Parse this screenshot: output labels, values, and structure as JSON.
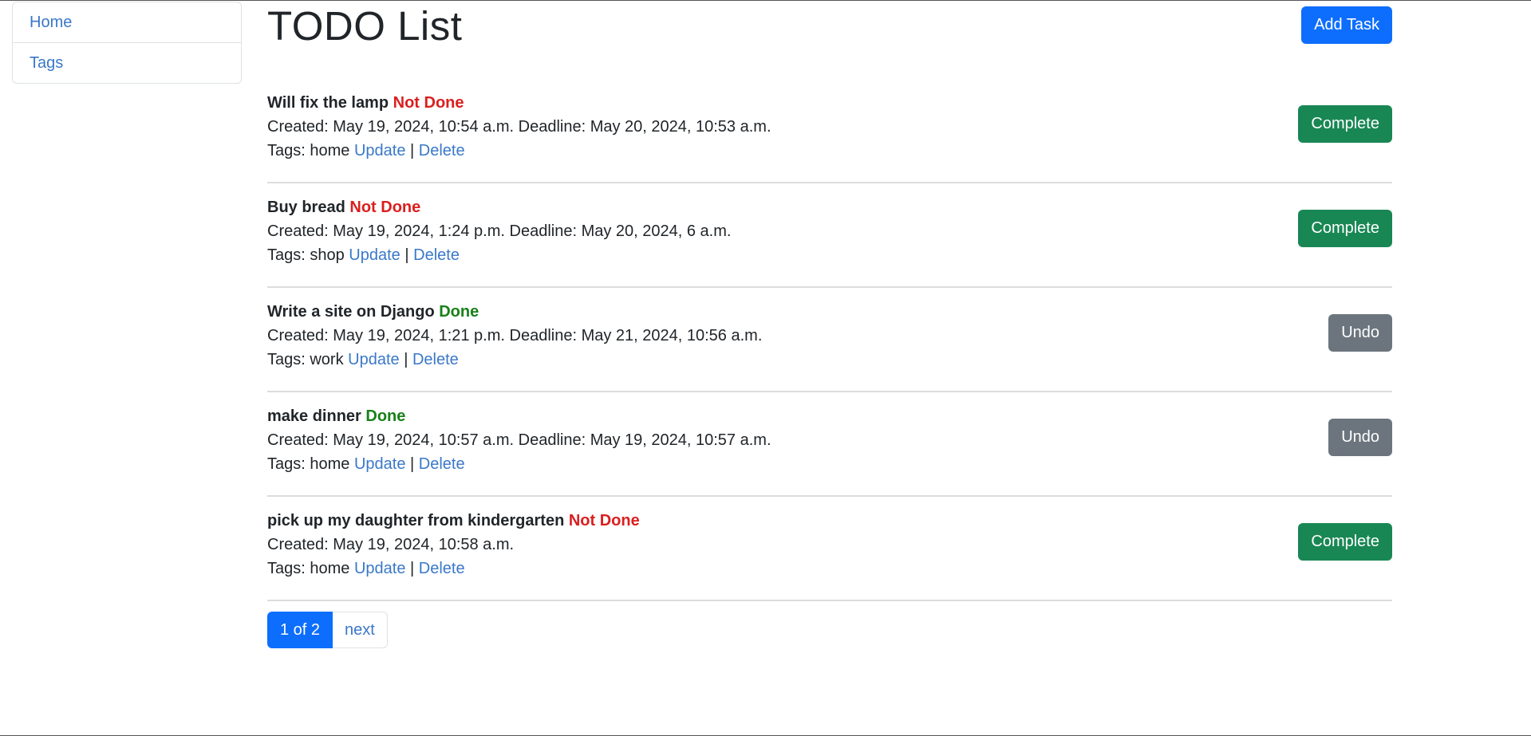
{
  "sidebar": {
    "items": [
      {
        "label": "Home"
      },
      {
        "label": "Tags"
      }
    ]
  },
  "header": {
    "title": "TODO List",
    "add_task_label": "Add Task"
  },
  "tasks": [
    {
      "title": "Will fix the lamp",
      "status": "Not Done",
      "details": "Created: May 19, 2024, 10:54 a.m. Deadline: May 20, 2024, 10:53 a.m.",
      "tags": "Tags: home",
      "update_label": "Update",
      "separator": "|",
      "delete_label": "Delete",
      "action_label": "Complete"
    },
    {
      "title": "Buy bread",
      "status": "Not Done",
      "details": "Created: May 19, 2024, 1:24 p.m. Deadline: May 20, 2024, 6 a.m.",
      "tags": "Tags: shop",
      "update_label": "Update",
      "separator": "|",
      "delete_label": "Delete",
      "action_label": "Complete"
    },
    {
      "title": "Write a site on Django",
      "status": "Done",
      "details": "Created: May 19, 2024, 1:21 p.m. Deadline: May 21, 2024, 10:56 a.m.",
      "tags": "Tags: work",
      "update_label": "Update",
      "separator": "|",
      "delete_label": "Delete",
      "action_label": "Undo"
    },
    {
      "title": "make dinner",
      "status": "Done",
      "details": "Created: May 19, 2024, 10:57 a.m. Deadline: May 19, 2024, 10:57 a.m.",
      "tags": "Tags: home",
      "update_label": "Update",
      "separator": "|",
      "delete_label": "Delete",
      "action_label": "Undo"
    },
    {
      "title": "pick up my daughter from kindergarten",
      "status": "Not Done",
      "details": "Created: May 19, 2024, 10:58 a.m.",
      "tags": "Tags: home",
      "update_label": "Update",
      "separator": "|",
      "delete_label": "Delete",
      "action_label": "Complete"
    }
  ],
  "pagination": {
    "current": "1 of 2",
    "next_label": "next"
  },
  "colors": {
    "primary": "#0d6efd",
    "success": "#198754",
    "secondary": "#6c757d",
    "not_done": "#dc1e1e",
    "done": "#198019",
    "link": "#3a78c8"
  }
}
